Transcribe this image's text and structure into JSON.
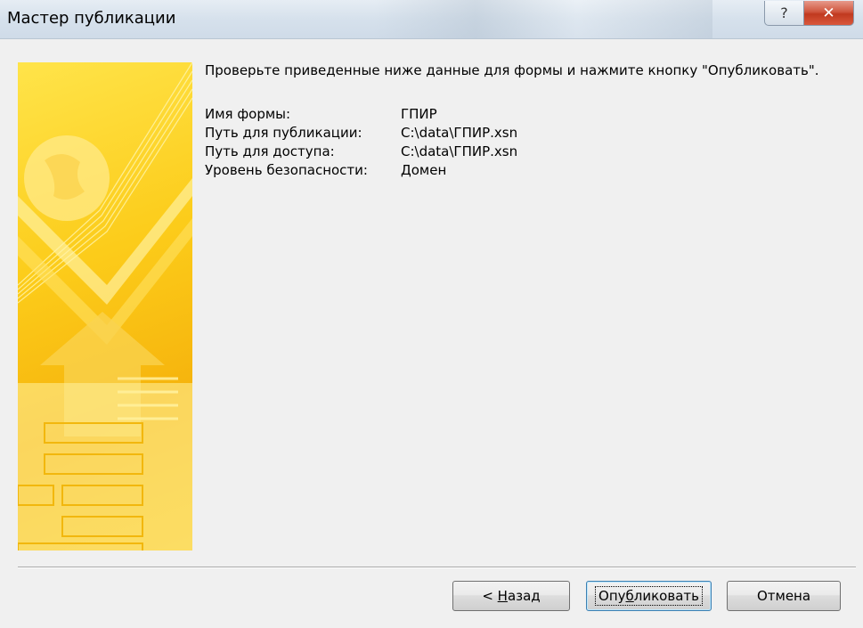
{
  "window": {
    "title": "Мастер публикации",
    "help_symbol": "?",
    "close_symbol": "✕"
  },
  "content": {
    "intro": "Проверьте приведенные ниже данные для формы и нажмите кнопку \"Опубликовать\".",
    "rows": [
      {
        "label": "Имя формы:",
        "value": "ГПИР"
      },
      {
        "label": "Путь для публикации:",
        "value": "C:\\data\\ГПИР.xsn"
      },
      {
        "label": "Путь для доступа:",
        "value": "C:\\data\\ГПИР.xsn"
      },
      {
        "label": "Уровень безопасности:",
        "value": "Домен"
      }
    ]
  },
  "buttons": {
    "back_prefix": "< ",
    "back_mnemonic": "Н",
    "back_rest": "азад",
    "publish_pre": "Опу",
    "publish_mnemonic": "б",
    "publish_rest": "ликовать",
    "cancel": "Отмена"
  },
  "colors": {
    "banner_yellow": "#fccc1a",
    "close_red": "#c0391f",
    "focus_blue": "#3c7fb1"
  },
  "icons": {
    "help": "help-icon",
    "close": "close-icon",
    "banner": "wizard-banner-graphic"
  }
}
